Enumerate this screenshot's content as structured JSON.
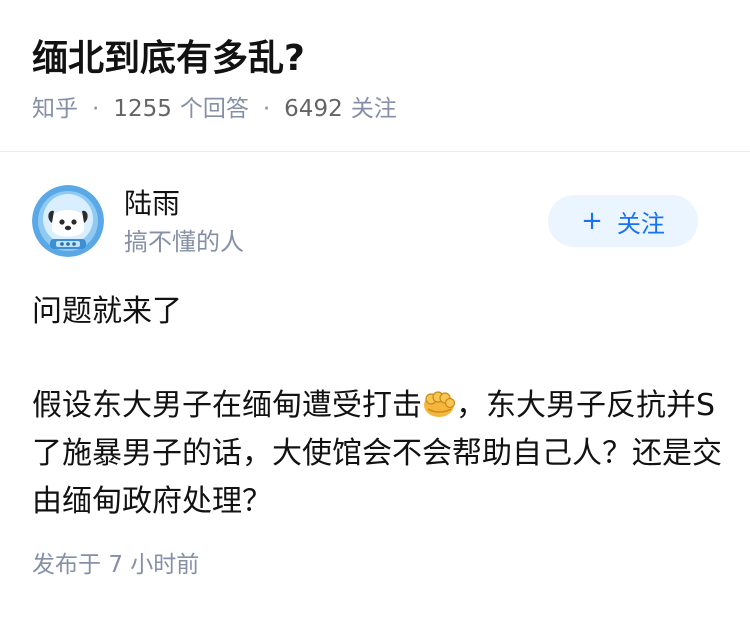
{
  "question": {
    "title": "缅北到底有多乱?",
    "source": "知乎",
    "separator": "·",
    "answer_count": "1255",
    "answer_label": "个回答",
    "follower_count": "6492",
    "follower_label": "关注"
  },
  "answer": {
    "author": {
      "name": "陆雨",
      "bio": "搞不懂的人",
      "avatar_icon": "astronaut-dog-avatar"
    },
    "follow_button": {
      "icon": "+",
      "label": "关注"
    },
    "content": {
      "paragraph_1": "问题就来了",
      "paragraph_2_before_emoji": "假设东大男子在缅甸遭受打击",
      "emoji_icon": "oncoming-fist-emoji",
      "paragraph_2_after_emoji": "，东大男子反抗并S了施暴男子的话，大使馆会不会帮助自己人？还是交由缅甸政府处理？"
    },
    "publish": {
      "label": "发布于",
      "time": "7 小时前"
    }
  },
  "colors": {
    "text_primary": "#121212",
    "text_secondary": "#8590a6",
    "accent_blue": "#1772f6",
    "follow_bg": "#ebf5ff",
    "divider": "#ebebeb"
  }
}
